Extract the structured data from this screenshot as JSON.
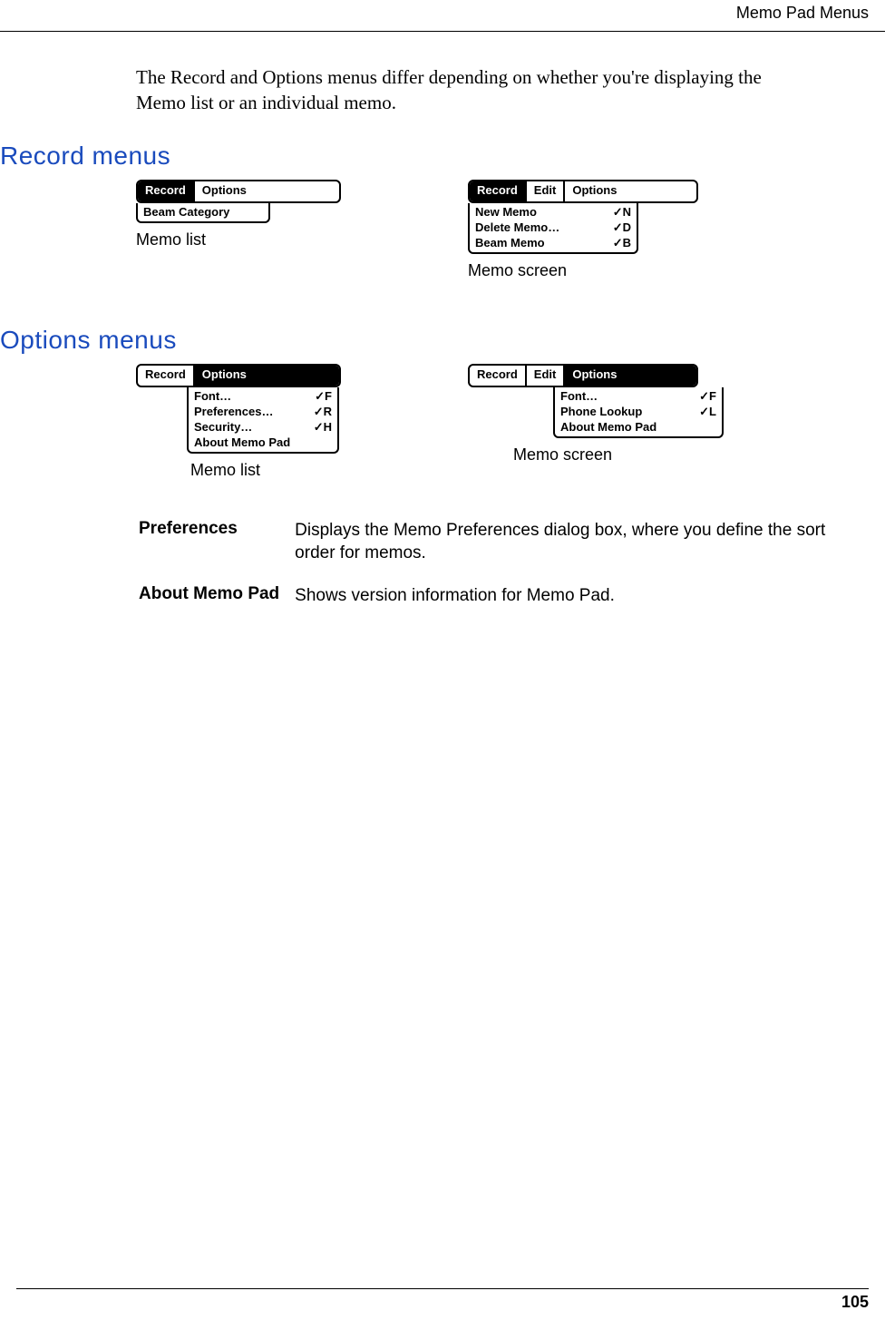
{
  "header": {
    "title": "Memo Pad Menus"
  },
  "intro": "The Record and Options menus differ depending on whether you're displaying the Memo list or an individual memo.",
  "sections": {
    "record": {
      "heading": "Record menus",
      "left": {
        "menubar": [
          {
            "label": "Record",
            "selected": true
          },
          {
            "label": "Options",
            "selected": false
          }
        ],
        "items": [
          {
            "label": "Beam Category",
            "shortcut": ""
          }
        ],
        "caption": "Memo list"
      },
      "right": {
        "menubar": [
          {
            "label": "Record",
            "selected": true
          },
          {
            "label": "Edit",
            "selected": false
          },
          {
            "label": "Options",
            "selected": false
          }
        ],
        "items": [
          {
            "label": "New Memo",
            "shortcut": "✓N"
          },
          {
            "label": "Delete Memo…",
            "shortcut": "✓D"
          },
          {
            "label": "Beam Memo",
            "shortcut": "✓B"
          }
        ],
        "caption": "Memo screen"
      }
    },
    "options": {
      "heading": "Options menus",
      "left": {
        "menubar": [
          {
            "label": "Record",
            "selected": false
          },
          {
            "label": "Options",
            "selected": true
          }
        ],
        "items": [
          {
            "label": "Font…",
            "shortcut": "✓F"
          },
          {
            "label": "Preferences…",
            "shortcut": "✓R"
          },
          {
            "label": "Security…",
            "shortcut": "✓H"
          },
          {
            "label": "About Memo Pad",
            "shortcut": ""
          }
        ],
        "caption": "Memo list"
      },
      "right": {
        "menubar": [
          {
            "label": "Record",
            "selected": false
          },
          {
            "label": "Edit",
            "selected": false
          },
          {
            "label": "Options",
            "selected": true
          }
        ],
        "items": [
          {
            "label": "Font…",
            "shortcut": "✓F"
          },
          {
            "label": "Phone Lookup",
            "shortcut": "✓L"
          },
          {
            "label": "About Memo Pad",
            "shortcut": ""
          }
        ],
        "caption": "Memo screen"
      }
    }
  },
  "definitions": [
    {
      "term": "Preferences",
      "desc": "Displays the Memo Preferences dialog box, where you define the sort order for memos."
    },
    {
      "term": "About Memo Pad",
      "desc": "Shows version information for Memo Pad."
    }
  ],
  "footer": {
    "page": "105"
  }
}
